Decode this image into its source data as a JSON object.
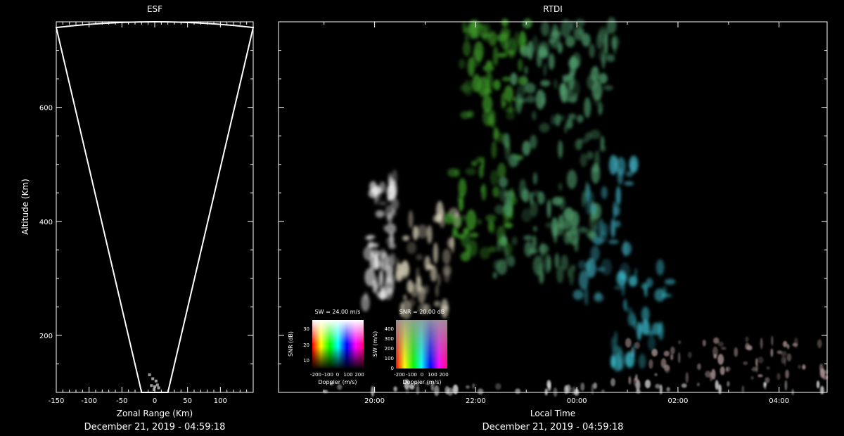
{
  "chart_data": [
    {
      "type": "scatter",
      "title": "ESF",
      "xlabel": "Zonal Range (Km)",
      "ylabel": "Altitude (Km)",
      "footer": "December 21, 2019 - 04:59:18",
      "xlim": [
        -150,
        150
      ],
      "ylim": [
        100,
        750
      ],
      "xticks": [
        -150,
        -100,
        -50,
        0,
        50,
        100
      ],
      "xtick_labels": [
        "-150",
        "-100",
        "-50",
        "0",
        "50",
        "100"
      ],
      "yticks": [
        200,
        400,
        600
      ],
      "ytick_labels": [
        "200",
        "400",
        "600"
      ],
      "beam_outline": [
        [
          -20,
          100
        ],
        [
          -150,
          740
        ],
        [
          -50,
          748
        ],
        [
          0,
          750
        ],
        [
          50,
          748
        ],
        [
          150,
          740
        ],
        [
          20,
          100
        ]
      ],
      "echo_points": [
        [
          -5,
          112
        ],
        [
          0,
          110
        ],
        [
          4,
          113
        ],
        [
          -3,
          124
        ],
        [
          2,
          120
        ],
        [
          -8,
          131
        ],
        [
          6,
          108
        ],
        [
          -1,
          105
        ]
      ],
      "grid": false
    },
    {
      "type": "heatmap",
      "title": "RTDI",
      "xlabel": "Local Time",
      "footer": "December 21, 2019 - 04:59:18",
      "xticks": [
        20,
        22,
        24,
        26,
        28
      ],
      "xtick_labels": [
        "20:00",
        "22:00",
        "00:00",
        "02:00",
        "04:00"
      ],
      "xlim": [
        18.1,
        28.95
      ],
      "ylim": [
        100,
        750
      ],
      "yticks": [
        200,
        400,
        600
      ],
      "plumes": [
        {
          "t": [
            18.1,
            28.95
          ],
          "alt": [
            100,
            118
          ],
          "color": "#e6e6e6",
          "density": 0.85
        },
        {
          "t": [
            25.0,
            28.95
          ],
          "alt": [
            118,
            195
          ],
          "color": "#b49a9a",
          "density": 0.7
        },
        {
          "t": [
            19.8,
            20.4
          ],
          "alt": [
            250,
            480
          ],
          "color": "#f0f0f0",
          "density": 0.9
        },
        {
          "t": [
            20.3,
            21.6
          ],
          "alt": [
            240,
            420
          ],
          "color": "#d8d0b8",
          "density": 0.6
        },
        {
          "t": [
            21.4,
            22.9
          ],
          "alt": [
            330,
            750
          ],
          "color": "#3fa02a",
          "density": 0.55
        },
        {
          "t": [
            22.3,
            24.6
          ],
          "alt": [
            300,
            750
          ],
          "color": "#4e9a6a",
          "density": 0.5
        },
        {
          "t": [
            24.0,
            25.1
          ],
          "alt": [
            260,
            520
          ],
          "color": "#3aa0b0",
          "density": 0.45
        },
        {
          "t": [
            24.6,
            25.8
          ],
          "alt": [
            150,
            320
          ],
          "color": "#38b8c8",
          "density": 0.5
        }
      ],
      "legends": [
        {
          "title": "SW = 24.00 m/s",
          "xlabel": "Doppler (m/s)",
          "ylabel": "SNR (dB)",
          "xtick_labels": [
            "-200",
            "-100",
            "0",
            "100",
            "200"
          ],
          "ytick_labels": [
            "30",
            "20",
            "10"
          ]
        },
        {
          "title": "SNR = 20.00 dB",
          "xlabel": "Doppler (m/s)",
          "ylabel": "SW (m/s)",
          "xtick_labels": [
            "-200",
            "-100",
            "0",
            "100",
            "200"
          ],
          "ytick_labels": [
            "400",
            "300",
            "200",
            "100",
            "0"
          ]
        }
      ]
    }
  ]
}
